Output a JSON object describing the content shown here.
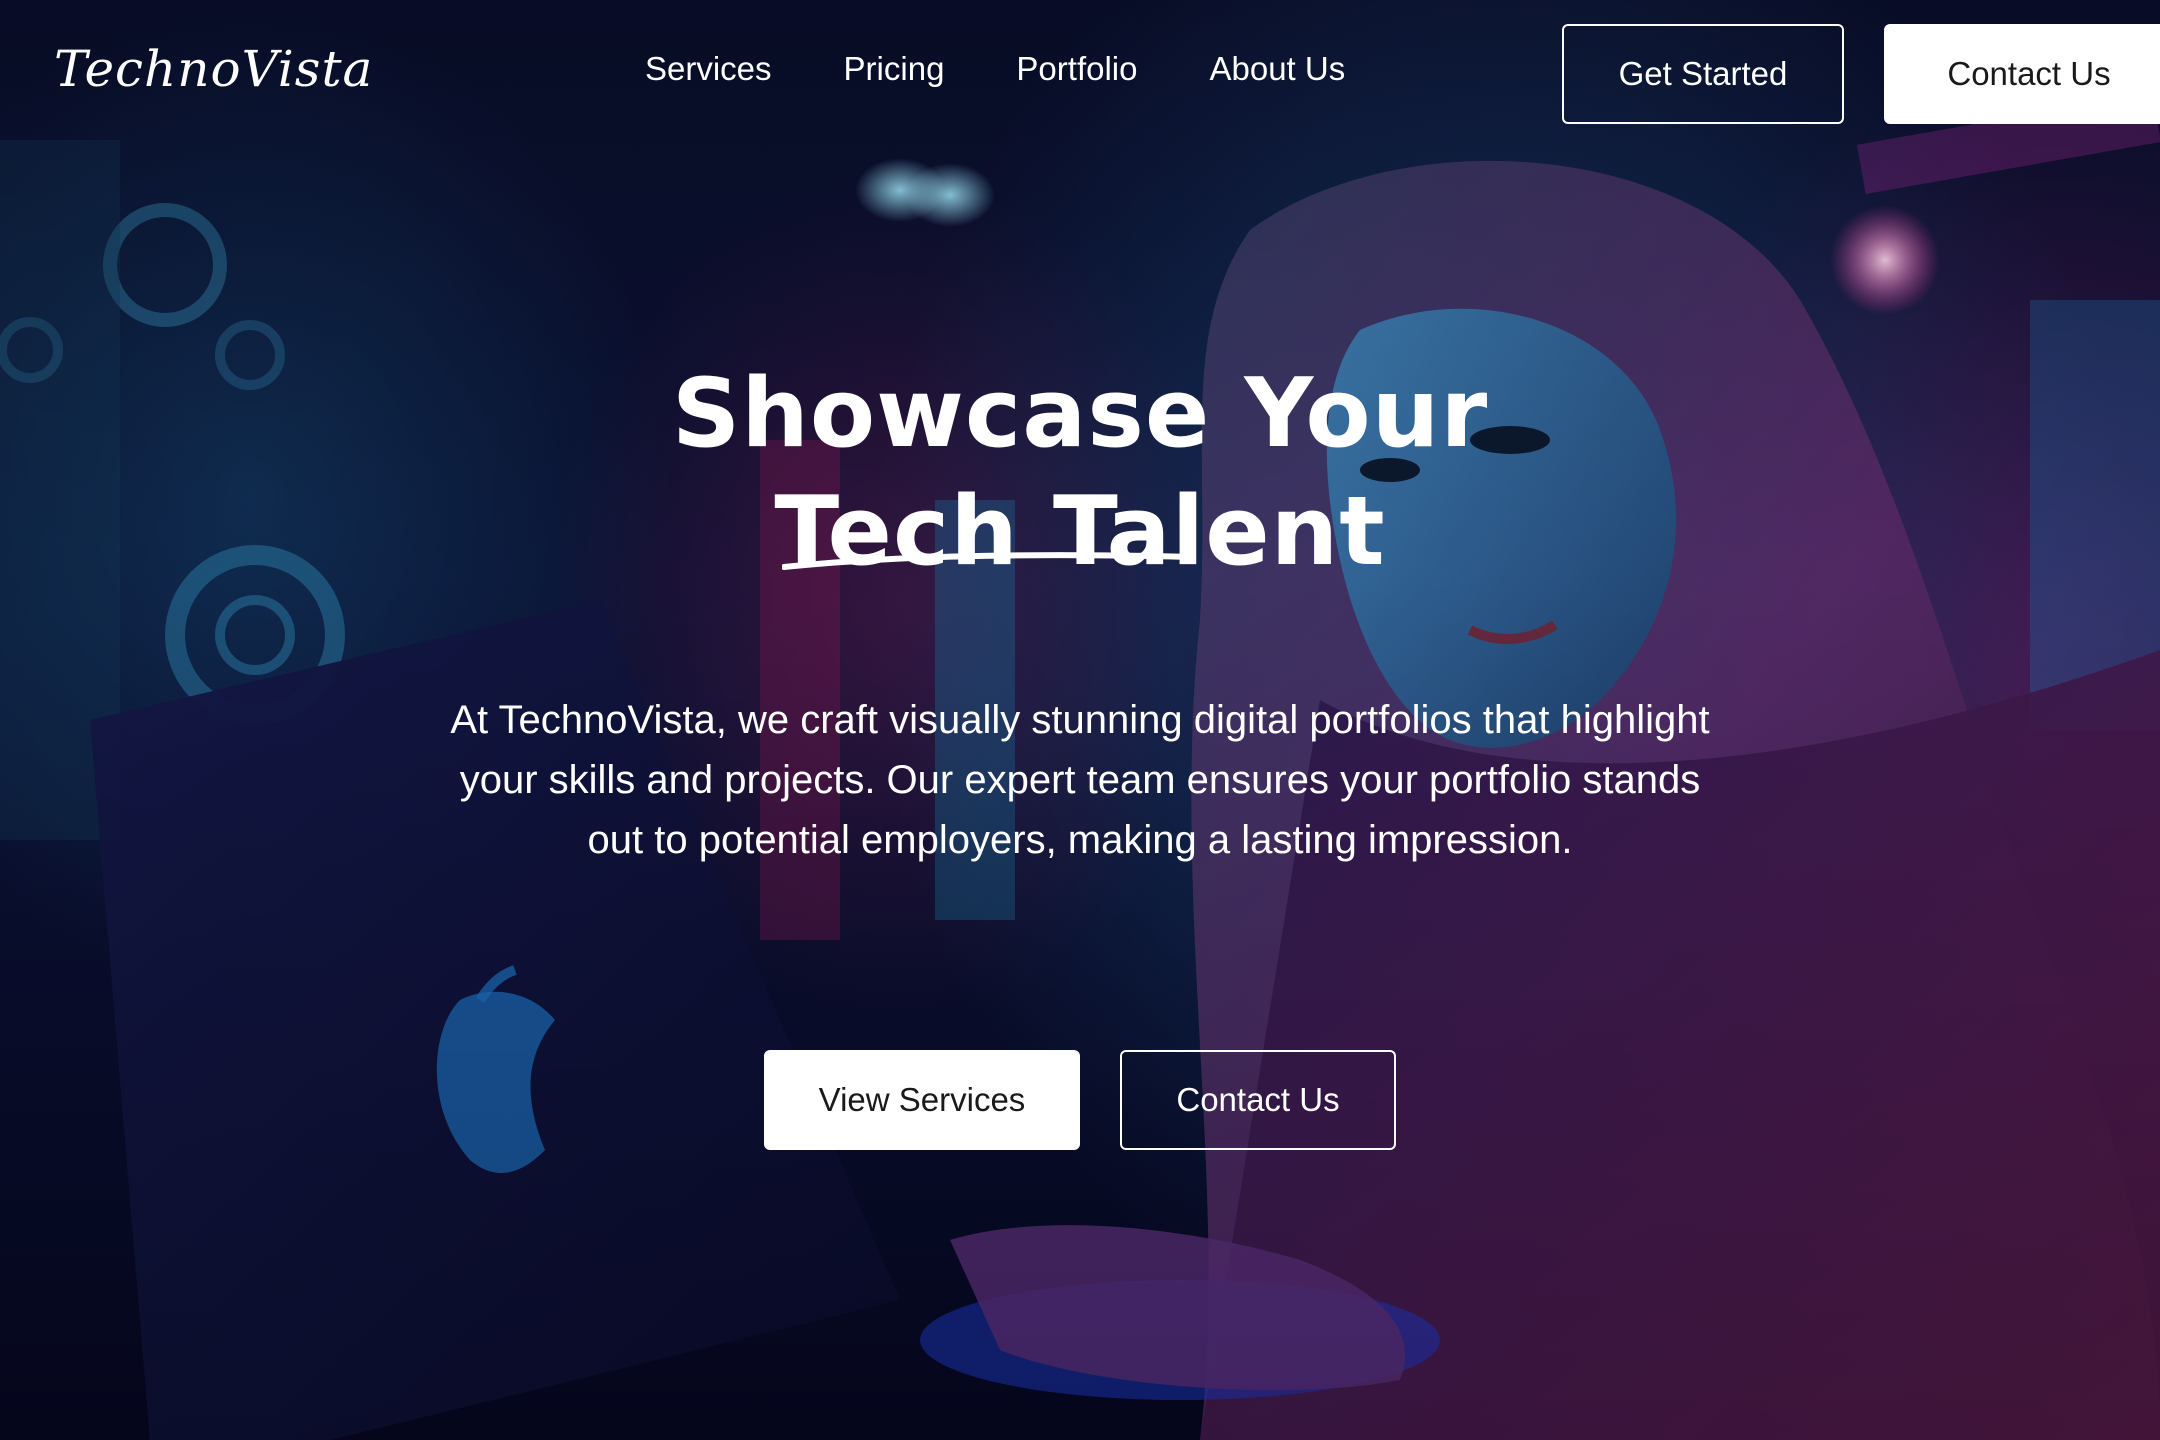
{
  "brand": {
    "logo": "TechnoVista"
  },
  "nav": {
    "links": [
      "Services",
      "Pricing",
      "Portfolio",
      "About Us"
    ],
    "get_started": "Get Started",
    "contact": "Contact Us"
  },
  "hero": {
    "headline_line1": "Showcase Your",
    "headline_line2": "Tech Talent",
    "description": "At TechnoVista, we craft visually stunning digital portfolios that highlight your skills and projects. Our expert team ensures your portfolio stands out to potential employers, making a lasting impression.",
    "primary_cta": "View Services",
    "secondary_cta": "Contact Us"
  },
  "colors": {
    "text": "#ffffff",
    "button_fill": "#ffffff",
    "button_text": "#1a1a1a",
    "background_dark": "#0a0f2e",
    "accent_magenta": "#a0287a",
    "accent_blue": "#2a6aa8"
  }
}
